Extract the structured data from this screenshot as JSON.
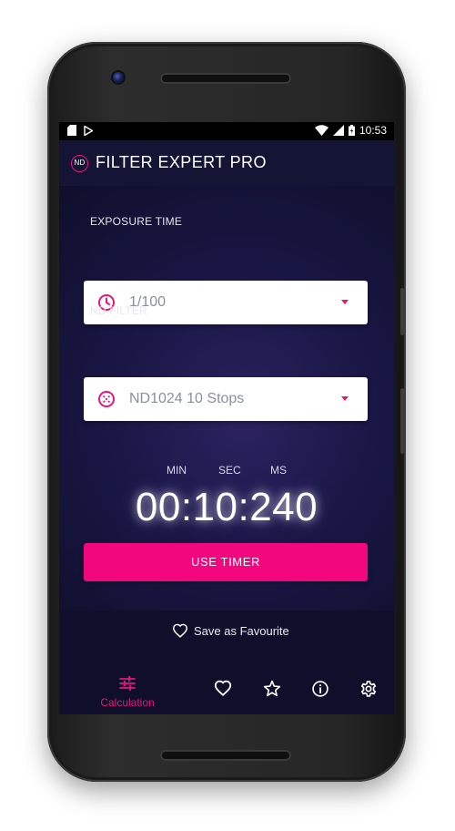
{
  "status_bar": {
    "time": "10:53"
  },
  "app": {
    "logo_text": "ND",
    "title": "FILTER EXPERT PRO"
  },
  "exposure": {
    "label": "EXPOSURE TIME",
    "value": "1/100",
    "icon": "clock-icon"
  },
  "nd_filter": {
    "label": "ND FILTER",
    "value": "ND1024 10 Stops",
    "icon": "filter-dots-icon"
  },
  "timer": {
    "labels": {
      "min": "MIN",
      "sec": "SEC",
      "ms": "MS"
    },
    "display": "00:10:240"
  },
  "actions": {
    "use_timer": "USE TIMER",
    "save_favourite": "Save as Favourite"
  },
  "bottom_nav": {
    "calculation_label": "Calculation",
    "items": [
      "sliders-icon",
      "heart-icon",
      "star-icon",
      "info-icon",
      "gear-icon"
    ]
  },
  "colors": {
    "accent": "#f2077f",
    "background": "#0f0f2b",
    "appbar": "#141435"
  }
}
